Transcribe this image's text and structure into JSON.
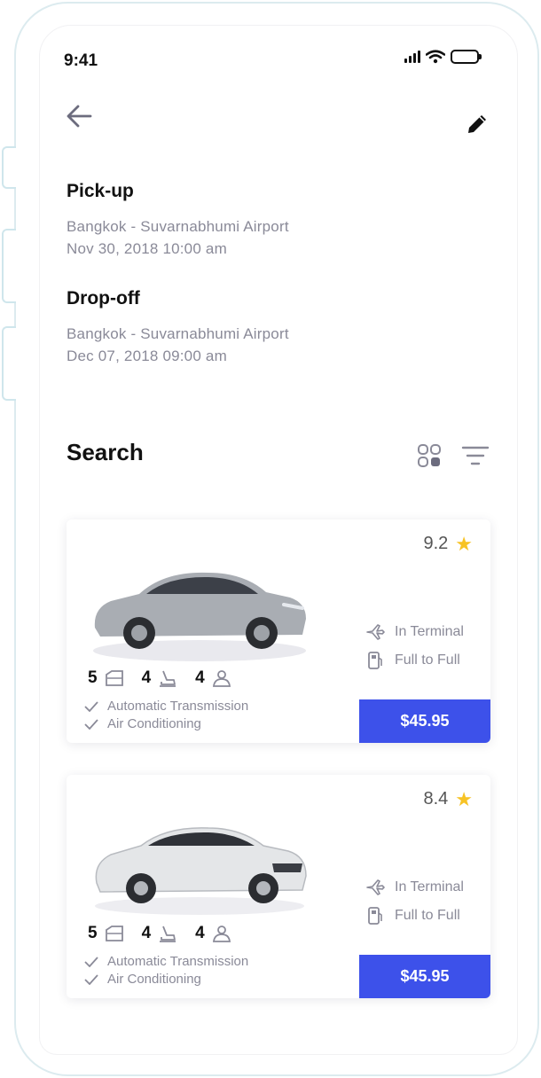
{
  "status": {
    "time": "9:41"
  },
  "pickup": {
    "title": "Pick-up",
    "location": "Bangkok - Suvarnabhumi Airport",
    "datetime": "Nov 30, 2018 10:00 am"
  },
  "dropoff": {
    "title": "Drop-off",
    "location": "Bangkok - Suvarnabhumi Airport",
    "datetime": "Dec 07, 2018 09:00 am"
  },
  "search": {
    "title": "Search"
  },
  "cars": [
    {
      "rating": "9.2",
      "doors": "5",
      "seats": "4",
      "passengers": "4",
      "features": [
        "Automatic Transmission",
        "Air Conditioning"
      ],
      "pickup_location": "In Terminal",
      "fuel_policy": "Full to Full",
      "price": "$45.95",
      "body_color": "#a9adb3"
    },
    {
      "rating": "8.4",
      "doors": "5",
      "seats": "4",
      "passengers": "4",
      "features": [
        "Automatic Transmission",
        "Air Conditioning"
      ],
      "pickup_location": "In Terminal",
      "fuel_policy": "Full to Full",
      "price": "$45.95",
      "body_color": "#e4e6e8"
    }
  ],
  "colors": {
    "accent": "#3d51ea",
    "star": "#f7c325",
    "muted_text": "#8a8a98"
  }
}
